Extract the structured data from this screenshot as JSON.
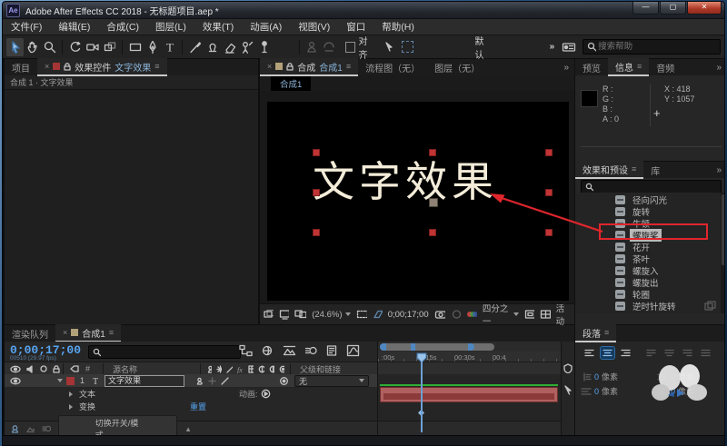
{
  "window": {
    "title": "Adobe After Effects CC 2018 - 无标题项目.aep *",
    "app_badge": "Ae"
  },
  "menu": {
    "items": [
      "文件(F)",
      "编辑(E)",
      "合成(C)",
      "图层(L)",
      "效果(T)",
      "动画(A)",
      "视图(V)",
      "窗口",
      "帮助(H)"
    ]
  },
  "toolbar": {
    "snap_label": "对齐",
    "workspace_label": "默认",
    "overflow": "»",
    "search_placeholder": "搜索帮助"
  },
  "project_panel": {
    "tab_project": "项目",
    "tab_effect_controls": "效果控件",
    "tab_effect_target": "文字效果",
    "breadcrumb": "合成 1 · 文字效果"
  },
  "comp_panel": {
    "tab_comp": "合成",
    "tab_comp_name": "合成1",
    "tab_flowchart": "流程图（无）",
    "tab_layer": "图层（无）",
    "overflow": "»",
    "subtab": "合成1",
    "canvas_text": "文字效果",
    "zoom": "(24.6%)",
    "timecode": "0;00;17;00",
    "resolution": "四分之一",
    "camera": "活动"
  },
  "info_panel": {
    "tab_preview": "预览",
    "tab_info": "信息",
    "tab_audio": "音频",
    "overflow": "»",
    "r": "R :",
    "g": "G :",
    "b": "B :",
    "a": "A : 0",
    "x": "X : 418",
    "y": "Y : 1057"
  },
  "effects_panel": {
    "tab_effects": "效果和预设",
    "tab_library": "库",
    "overflow": "»",
    "items": [
      "径向闪光",
      "旋转",
      "牛顿",
      "螺旋桨",
      "花开",
      "茶叶",
      "螺旋入",
      "螺旋出",
      "轮圈",
      "逆时针旋转"
    ],
    "selected_index": 3
  },
  "paragraph_panel": {
    "title": "段落",
    "fields": [
      {
        "value": "0",
        "unit": "像素"
      },
      {
        "value": "0",
        "unit": "像素"
      },
      {
        "value": "0",
        "unit": "像素"
      },
      {
        "value": "0",
        "unit": "像素"
      }
    ]
  },
  "timeline": {
    "tab_render_queue": "渲染队列",
    "tab_comp": "合成1",
    "timecode": "0;00;17;00",
    "frame_info": "00510 (29.97 fps)",
    "col_source_name": "源名称",
    "col_hash": "#",
    "col_parent": "父级和链接",
    "layer_number": "1",
    "layer_name": "文字效果",
    "parent_value": "无",
    "row_text": "文本",
    "animate_label": "动画:",
    "row_transform": "变换",
    "reset_label": "重置",
    "toggle_label": "切换开关/模式",
    "ruler": [
      ":00s",
      "00:15s",
      "00:30s",
      "00:4"
    ]
  },
  "colors": {
    "accent_red": "#e0262c",
    "timecode_blue": "#57a4f0",
    "text_cream": "#f3ecd9"
  }
}
